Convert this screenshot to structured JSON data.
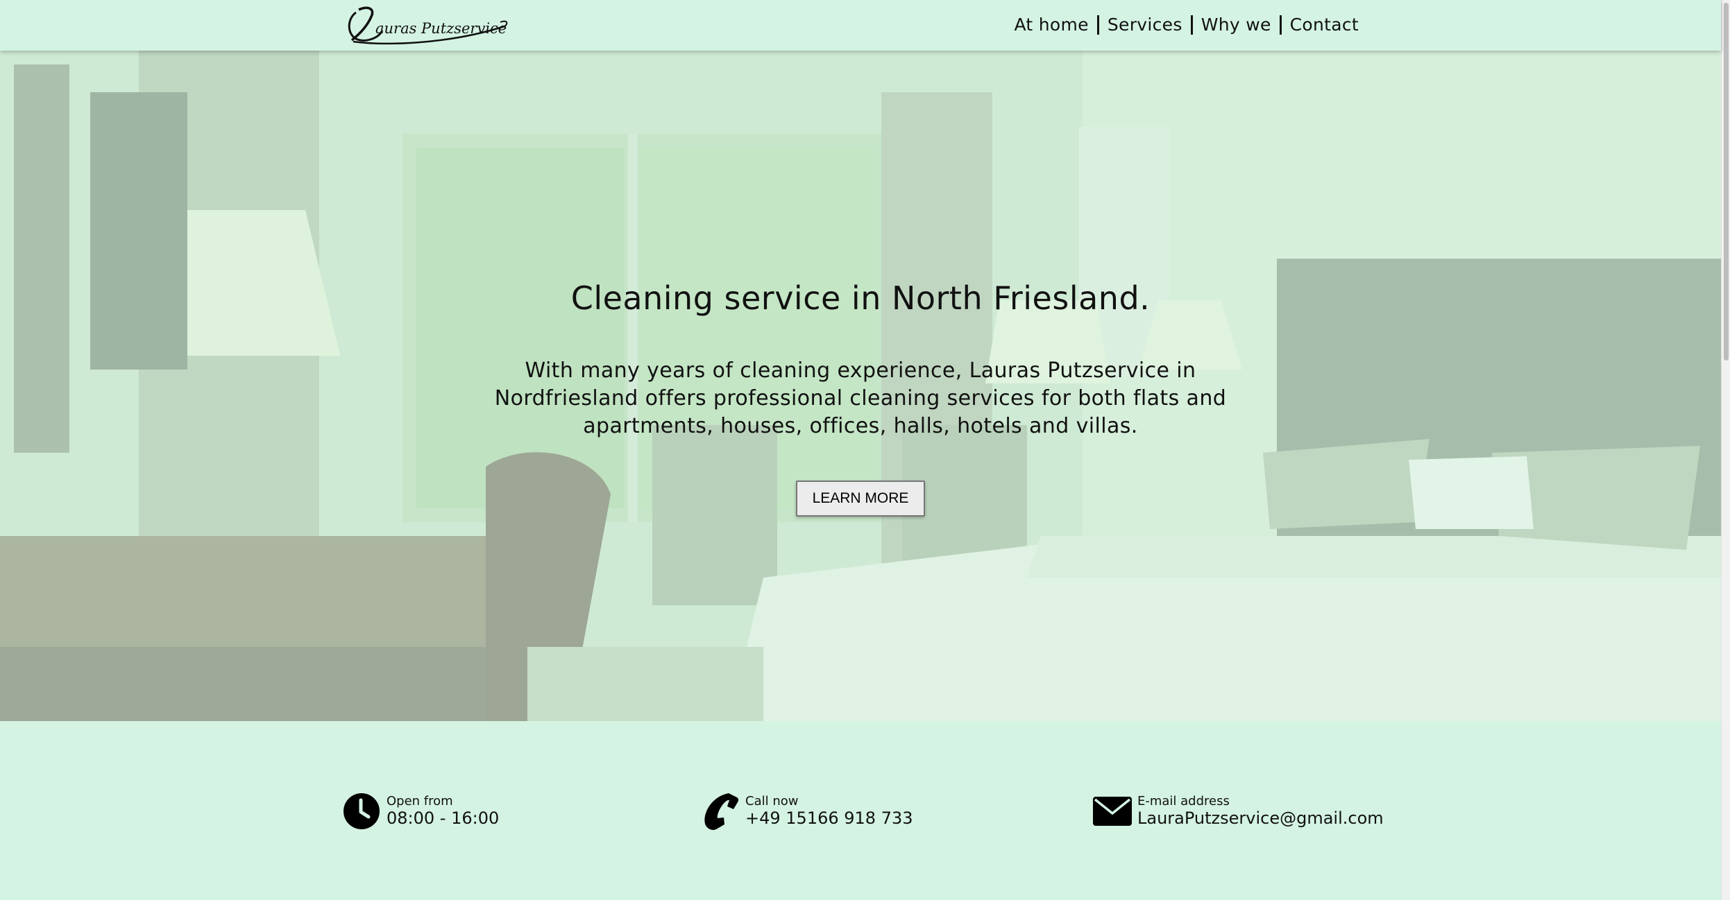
{
  "header": {
    "logo_alt": "Lauras Putzservice",
    "nav": [
      {
        "label": "At home"
      },
      {
        "label": "Services"
      },
      {
        "label": "Why we"
      },
      {
        "label": "Contact"
      }
    ]
  },
  "hero": {
    "title": "Cleaning service in North Friesland.",
    "text": "With many years of cleaning experience, Lauras Putzservice in Nordfriesland offers professional cleaning services for both flats and apartments, houses, offices, halls, hotels and villas.",
    "button_label": "LEARN MORE"
  },
  "info": {
    "hours": {
      "label": "Open from",
      "value": "08:00 - 16:00",
      "icon": "clock-icon"
    },
    "phone": {
      "label": "Call now",
      "value": "+49 15166 918 733",
      "icon": "phone-icon"
    },
    "email": {
      "label": "E-mail address",
      "value": "LauraPutzservice@gmail.com",
      "icon": "envelope-icon"
    }
  },
  "colors": {
    "background": "#d4f3e3",
    "text": "#111111",
    "button_bg": "#ececec"
  }
}
